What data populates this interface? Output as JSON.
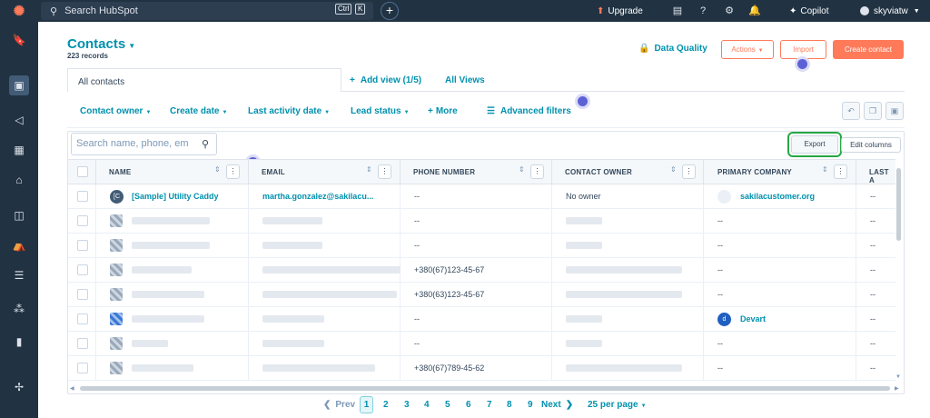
{
  "topbar": {
    "search_placeholder": "Search HubSpot",
    "kbd1": "Ctrl",
    "kbd2": "K",
    "upgrade": "Upgrade",
    "copilot": "Copilot",
    "user": "skyviatw"
  },
  "header": {
    "title": "Contacts",
    "record_count": "223 records",
    "data_quality": "Data Quality",
    "actions": "Actions",
    "import": "Import",
    "create": "Create contact"
  },
  "tabs": {
    "active": "All contacts",
    "add_view": "Add view (1/5)",
    "all_views": "All Views"
  },
  "filters": {
    "owner": "Contact owner",
    "create_date": "Create date",
    "last_activity": "Last activity date",
    "lead_status": "Lead status",
    "more": "More",
    "advanced": "Advanced filters"
  },
  "table": {
    "search_placeholder": "Search name, phone, em",
    "export": "Export",
    "edit_columns": "Edit columns",
    "columns": [
      "NAME",
      "EMAIL",
      "PHONE NUMBER",
      "CONTACT OWNER",
      "PRIMARY COMPANY",
      "LAST A"
    ],
    "rows": [
      {
        "name": "[Sample] Utility Caddy",
        "email": "martha.gonzalez@sakilacu...",
        "phone": "--",
        "owner": "No owner",
        "company": "sakilacustomer.org",
        "last": "--"
      },
      {
        "name": "",
        "email": "",
        "phone": "--",
        "owner": "",
        "company": "--",
        "last": "--"
      },
      {
        "name": "",
        "email": "",
        "phone": "--",
        "owner": "",
        "company": "--",
        "last": "--"
      },
      {
        "name": "",
        "email": "",
        "phone": "+380(67)123-45-67",
        "owner": "",
        "company": "--",
        "last": "--"
      },
      {
        "name": "",
        "email": "",
        "phone": "+380(63)123-45-67",
        "owner": "",
        "company": "--",
        "last": "--"
      },
      {
        "name": "",
        "email": "",
        "phone": "--",
        "owner": "",
        "company": "Devart",
        "last": "--"
      },
      {
        "name": "",
        "email": "",
        "phone": "--",
        "owner": "",
        "company": "--",
        "last": "--"
      },
      {
        "name": "",
        "email": "",
        "phone": "+380(67)789-45-62",
        "owner": "",
        "company": "--",
        "last": "--"
      }
    ]
  },
  "pagination": {
    "prev": "Prev",
    "pages": [
      "1",
      "2",
      "3",
      "4",
      "5",
      "6",
      "7",
      "8",
      "9"
    ],
    "next": "Next",
    "per_page": "25 per page"
  },
  "colors": {
    "accent": "#0091ae",
    "brand": "#ff7a59",
    "nav": "#213343"
  }
}
